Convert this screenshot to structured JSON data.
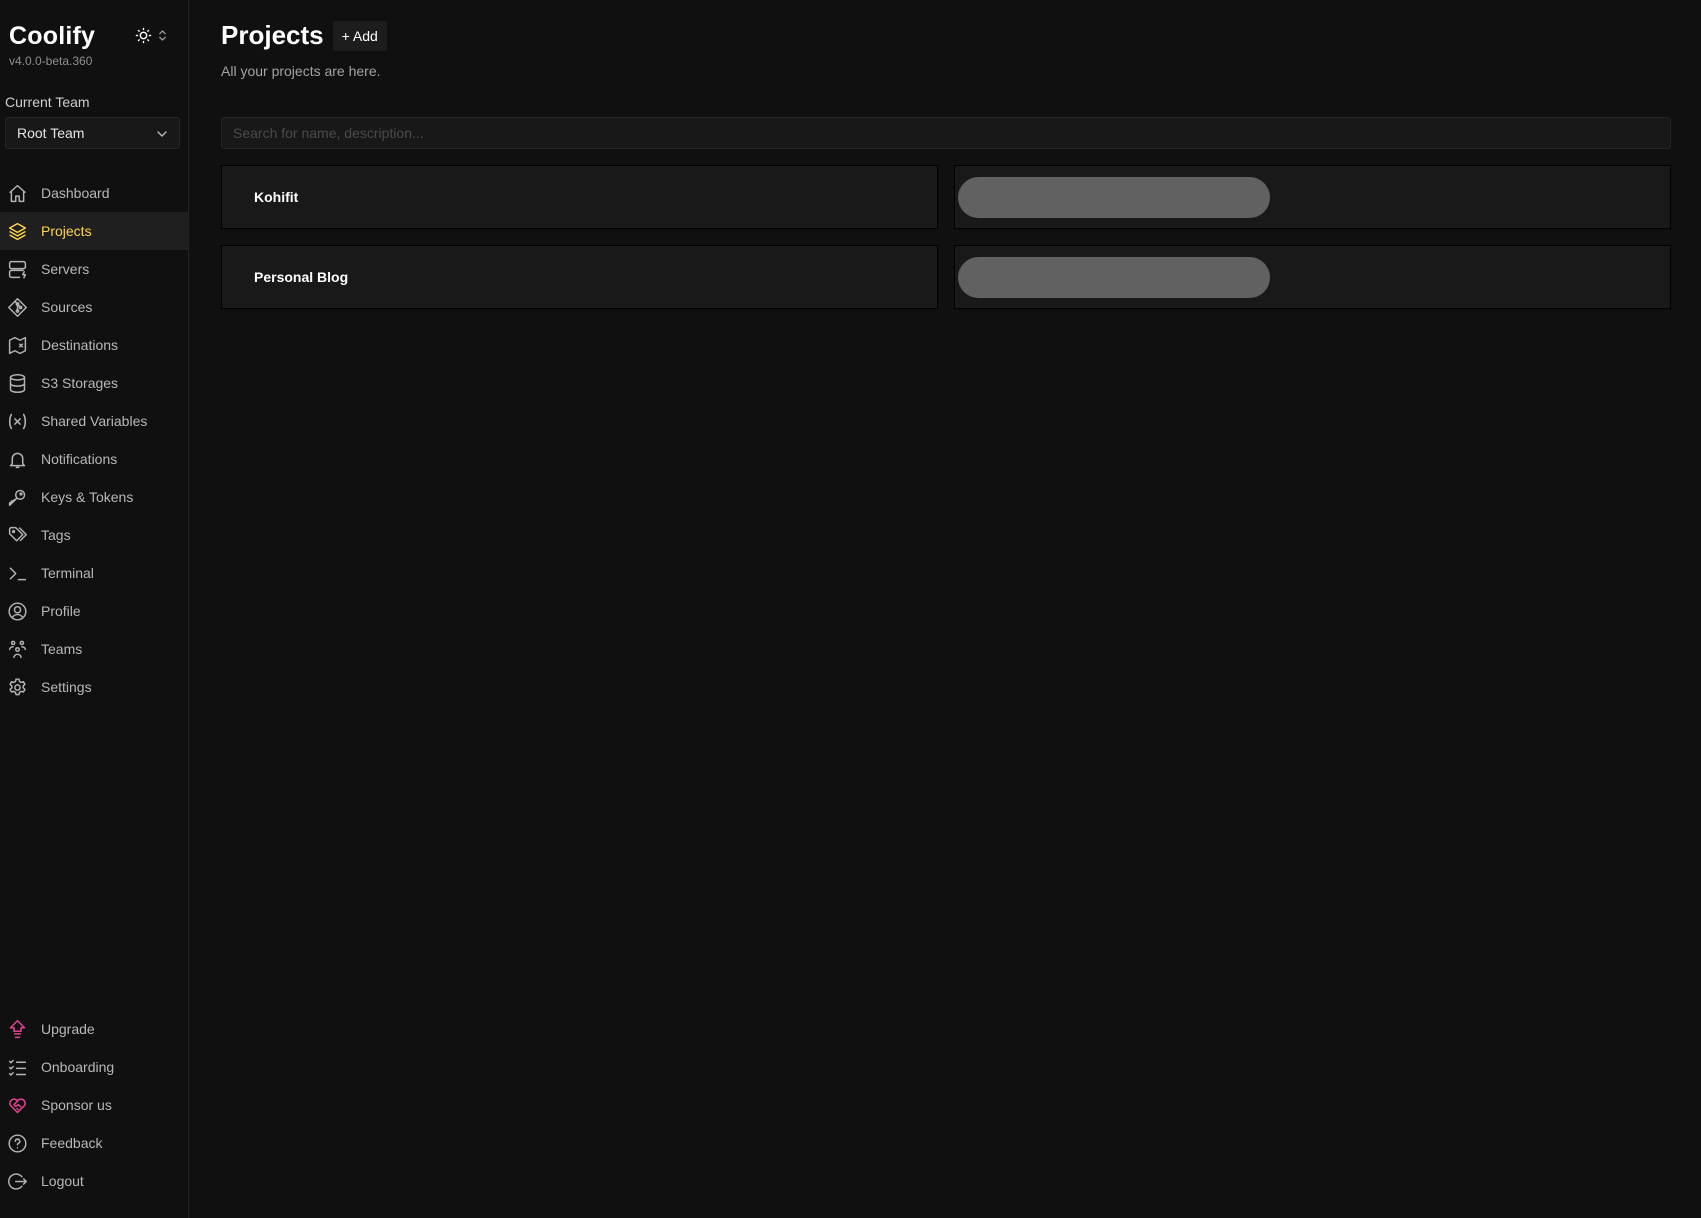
{
  "app": {
    "name": "Coolify",
    "version": "v4.0.0-beta.360"
  },
  "theme_toggle": {
    "icon": "sun-icon",
    "chevron": "chevron-up-down-icon"
  },
  "team": {
    "label": "Current Team",
    "selected": "Root Team"
  },
  "nav": {
    "items": [
      {
        "label": "Dashboard",
        "icon": "home-icon",
        "active": false
      },
      {
        "label": "Projects",
        "icon": "layers-icon",
        "active": true
      },
      {
        "label": "Servers",
        "icon": "server-icon",
        "active": false
      },
      {
        "label": "Sources",
        "icon": "git-icon",
        "active": false
      },
      {
        "label": "Destinations",
        "icon": "map-icon",
        "active": false
      },
      {
        "label": "S3 Storages",
        "icon": "database-icon",
        "active": false
      },
      {
        "label": "Shared Variables",
        "icon": "variable-icon",
        "active": false
      },
      {
        "label": "Notifications",
        "icon": "bell-icon",
        "active": false
      },
      {
        "label": "Keys & Tokens",
        "icon": "key-icon",
        "active": false
      },
      {
        "label": "Tags",
        "icon": "tags-icon",
        "active": false
      },
      {
        "label": "Terminal",
        "icon": "terminal-icon",
        "active": false
      },
      {
        "label": "Profile",
        "icon": "user-circle-icon",
        "active": false
      },
      {
        "label": "Teams",
        "icon": "users-icon",
        "active": false
      },
      {
        "label": "Settings",
        "icon": "gear-icon",
        "active": false
      }
    ],
    "bottom": [
      {
        "label": "Upgrade",
        "icon": "upgrade-arrow-icon"
      },
      {
        "label": "Onboarding",
        "icon": "checklist-icon"
      },
      {
        "label": "Sponsor us",
        "icon": "heart-handshake-icon"
      },
      {
        "label": "Feedback",
        "icon": "question-circle-icon"
      },
      {
        "label": "Logout",
        "icon": "logout-icon"
      }
    ]
  },
  "colors": {
    "accent": "#fcd452",
    "pink": "#e0428e",
    "background": "#101010",
    "card": "#191919",
    "skeleton": "#616161"
  },
  "page": {
    "title": "Projects",
    "add_label": "+ Add",
    "subtitle": "All your projects are here.",
    "search_placeholder": "Search for name, description...",
    "search_value": ""
  },
  "projects": [
    {
      "name": "Kohifit",
      "status": "loading"
    },
    {
      "name": "Personal Blog",
      "status": "loading"
    }
  ]
}
